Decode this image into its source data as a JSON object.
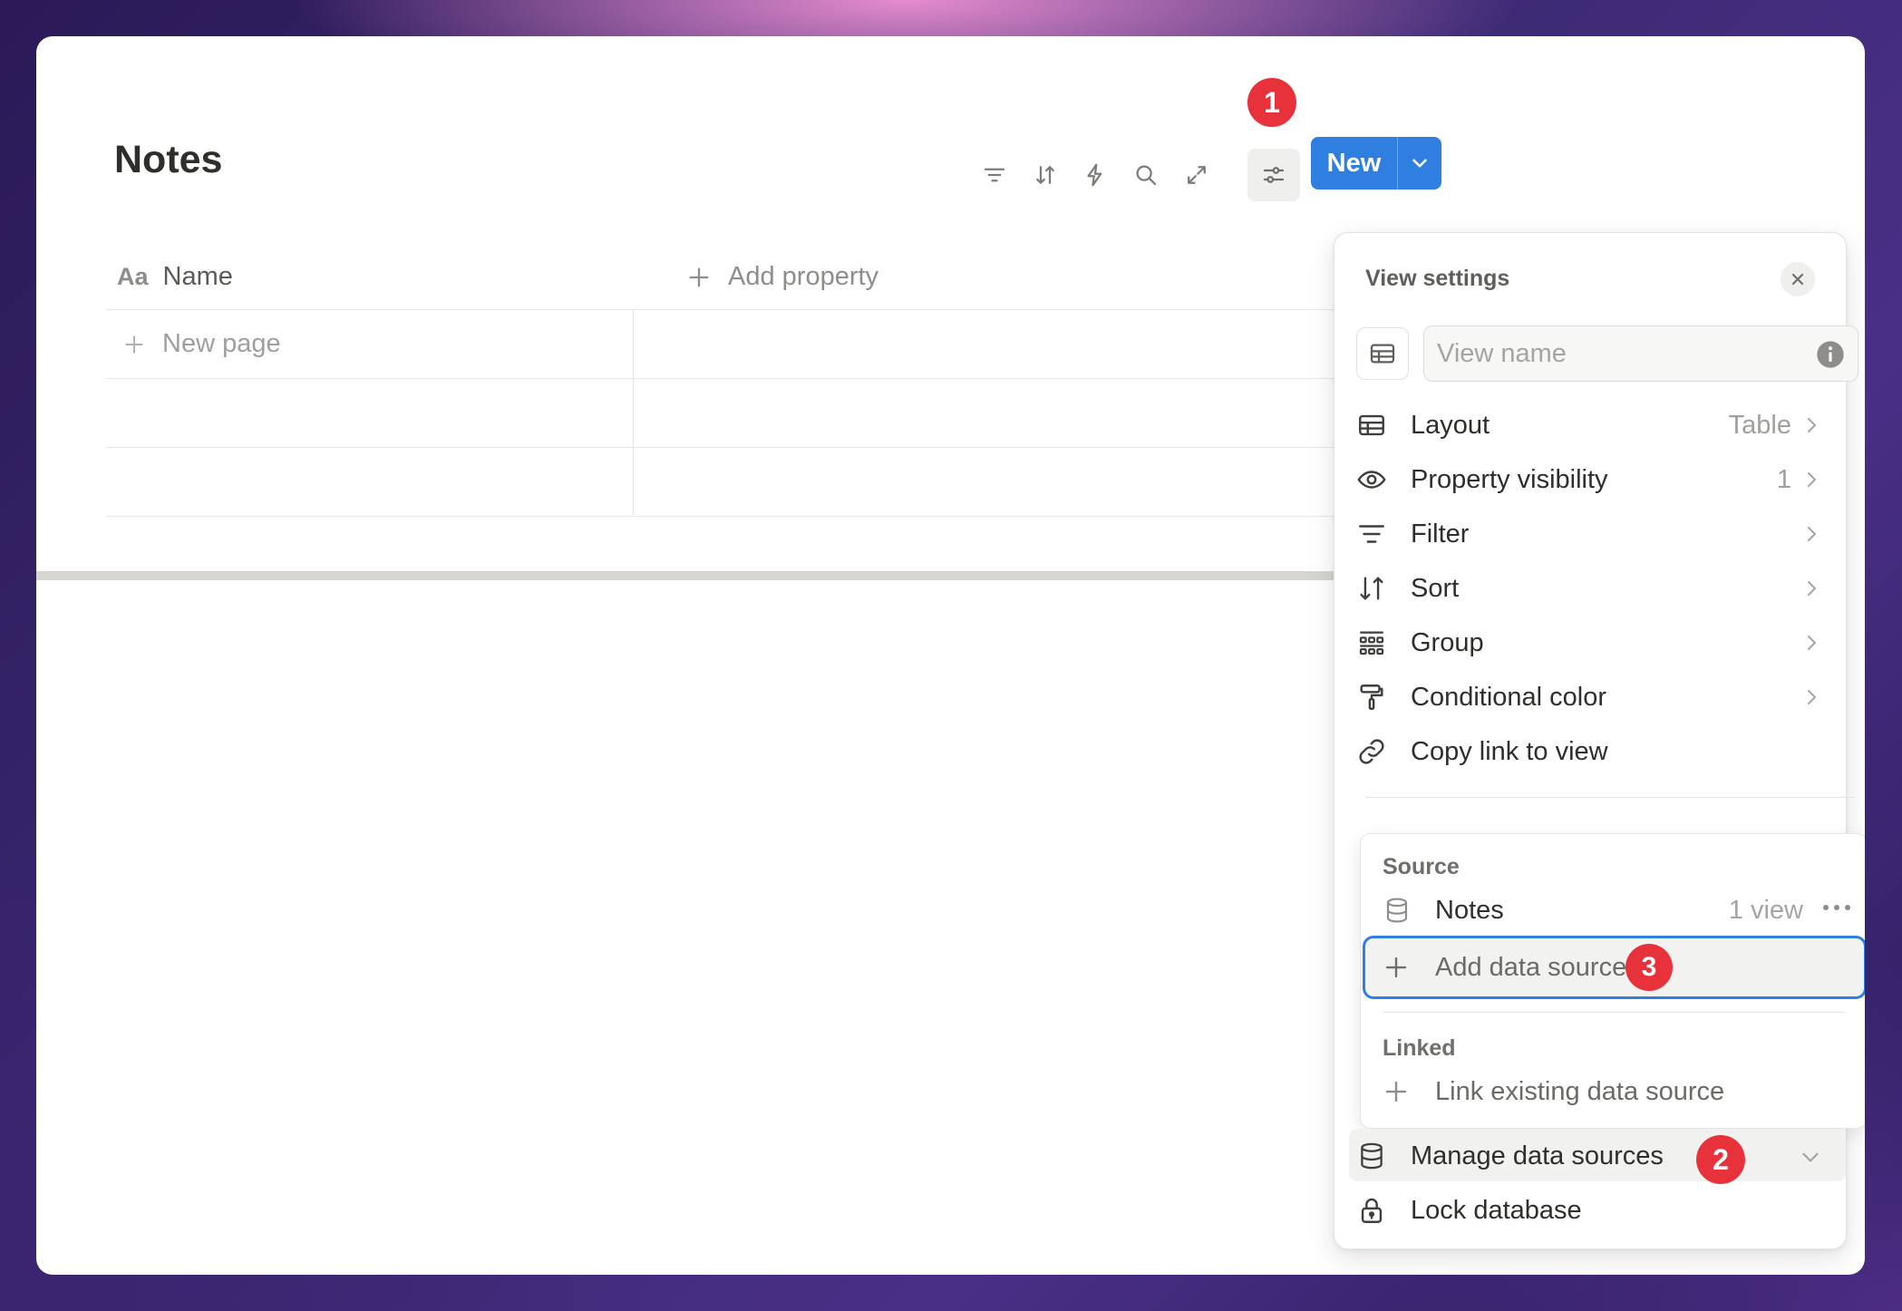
{
  "page": {
    "title": "Notes"
  },
  "toolbar": {
    "icons": [
      "filter-icon",
      "sort-icon",
      "lightning-icon",
      "search-icon",
      "expand-icon",
      "settings-sliders-icon"
    ],
    "new_label": "New"
  },
  "table": {
    "columns": [
      {
        "icon": "text-aa-icon",
        "icon_text": "Aa",
        "label": "Name"
      },
      {
        "icon": "plus-icon",
        "label": "Add property"
      }
    ],
    "new_page_label": "New page"
  },
  "annotations": {
    "badge1": "1",
    "badge2": "2",
    "badge3": "3"
  },
  "view_settings": {
    "title": "View settings",
    "view_name_placeholder": "View name",
    "items": [
      {
        "icon": "table-icon",
        "label": "Layout",
        "value": "Table"
      },
      {
        "icon": "eye-icon",
        "label": "Property visibility",
        "value": "1"
      },
      {
        "icon": "filter-icon",
        "label": "Filter",
        "value": ""
      },
      {
        "icon": "sort-icon",
        "label": "Sort",
        "value": ""
      },
      {
        "icon": "group-icon",
        "label": "Group",
        "value": ""
      },
      {
        "icon": "paint-roller-icon",
        "label": "Conditional color",
        "value": ""
      },
      {
        "icon": "link-icon",
        "label": "Copy link to view",
        "value": ""
      }
    ],
    "source": {
      "section_label": "Source",
      "item_name": "Notes",
      "item_value": "1 view",
      "add_label": "Add data source"
    },
    "linked": {
      "section_label": "Linked",
      "add_label": "Link existing data source"
    },
    "manage_label": "Manage data sources",
    "lock_label": "Lock database"
  },
  "colors": {
    "accent": "#2f7fe0",
    "badge": "#e8323b"
  }
}
